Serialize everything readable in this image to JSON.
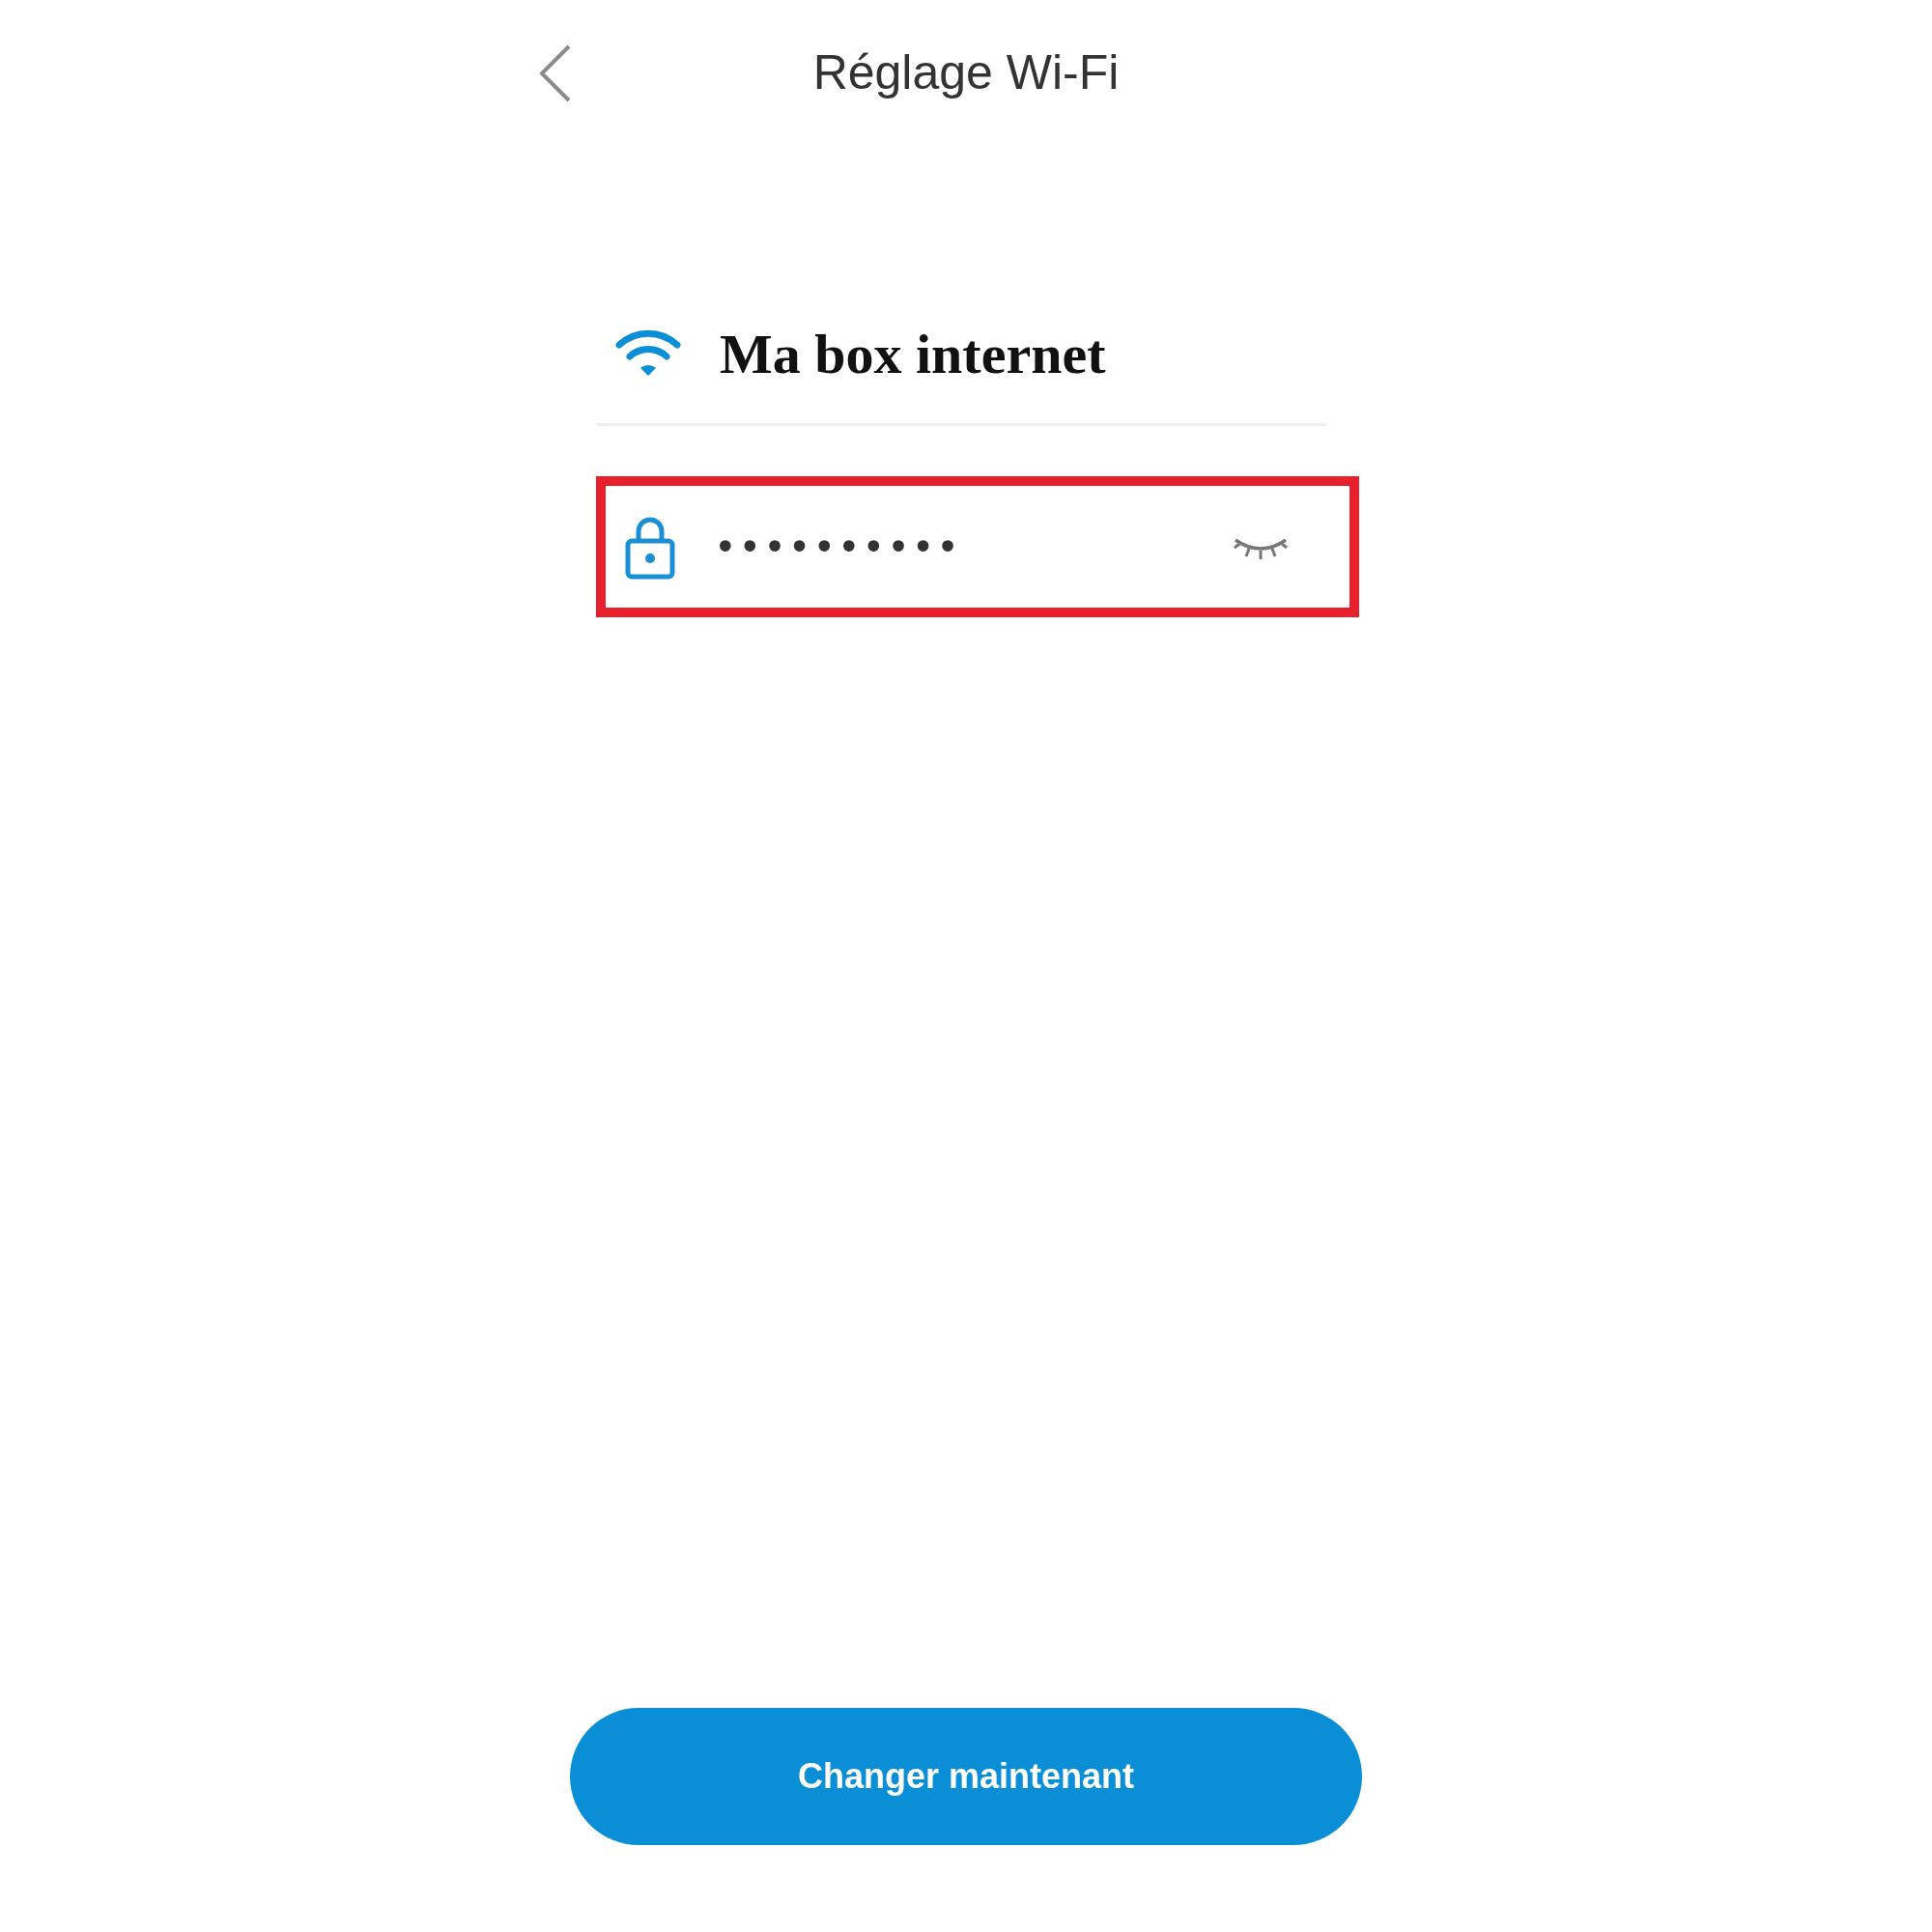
{
  "header": {
    "title": "Réglage Wi-Fi"
  },
  "network": {
    "name": "Ma box internet"
  },
  "password": {
    "value": "••••••••••",
    "visible": false,
    "highlighted": true
  },
  "button": {
    "label": "Changer maintenant"
  }
}
